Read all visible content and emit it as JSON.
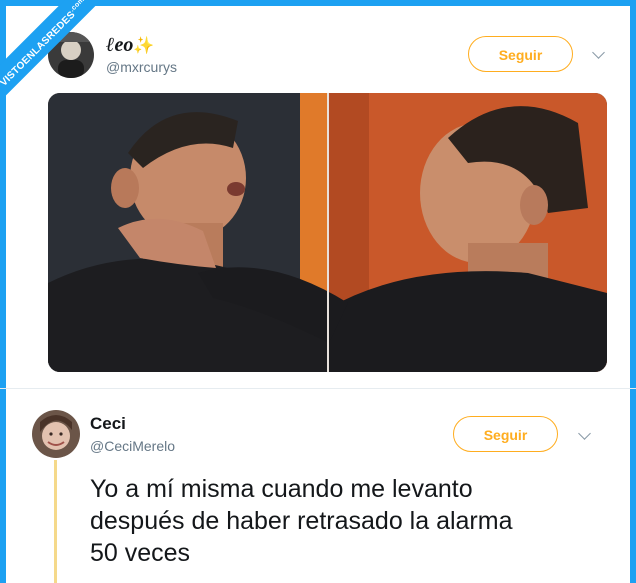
{
  "watermark": {
    "text": "VISTOENLASREDES",
    "suffix": ".com"
  },
  "tweet1": {
    "name": "ℓeo",
    "sparkle": "✨",
    "handle": "@mxrcurys",
    "follow_label": "Seguir"
  },
  "tweet2": {
    "name": "Ceci",
    "handle": "@CeciMerelo",
    "follow_label": "Seguir",
    "text_lines": [
      "Yo a mí misma cuando me levanto",
      "después de haber retrasado la alarma",
      "50 veces"
    ]
  },
  "colors": {
    "accent": "#ffad1f",
    "brand": "#1da1f2",
    "handle": "#657786"
  },
  "icons": [
    "chevron-down-icon",
    "sparkle-icon"
  ]
}
